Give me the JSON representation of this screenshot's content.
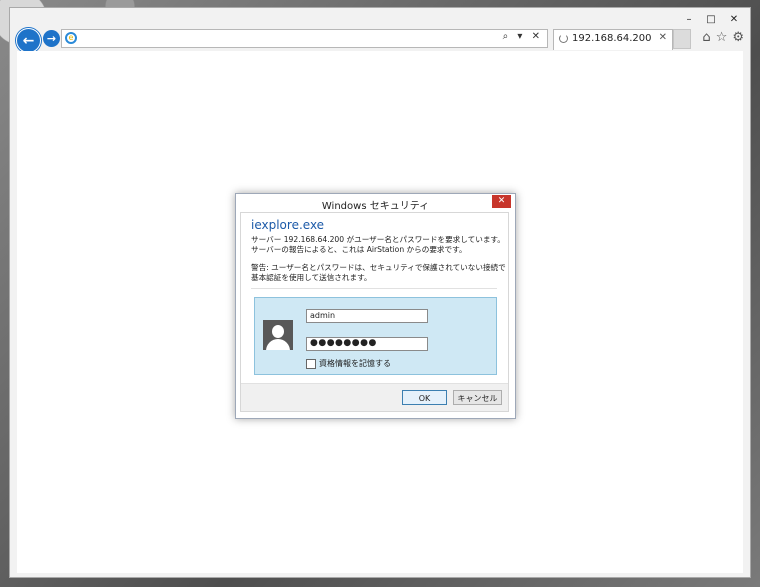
{
  "browser": {
    "address_value": "",
    "tab_title": "192.168.64.200",
    "address_tools": "⌕ ▾ ✕",
    "caption": {
      "minimize": "–",
      "maximize": "□",
      "close": "✕"
    },
    "icons": {
      "home": "⌂",
      "favorites": "☆",
      "settings": "⚙"
    }
  },
  "dialog": {
    "title": "Windows セキュリティ",
    "app_name": "iexplore.exe",
    "message": "サーバー 192.168.64.200 がユーザー名とパスワードを要求しています。サーバーの報告によると、これは AirStation からの要求です。",
    "warning": "警告: ユーザー名とパスワードは、セキュリティで保護されていない接続で基本認証を使用して送信されます。",
    "username_value": "admin",
    "password_mask": "●●●●●●●●",
    "remember_label": "資格情報を記憶する",
    "remember_checked": false,
    "ok_label": "OK",
    "cancel_label": "キャンセル",
    "close_glyph": "✕"
  }
}
